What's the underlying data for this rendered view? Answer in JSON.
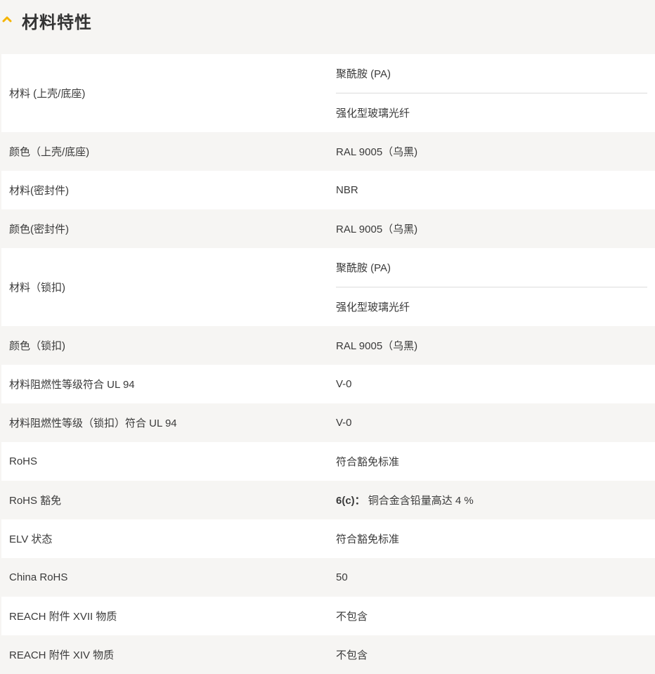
{
  "section": {
    "title": "材料特性",
    "icon": "chevron-up-icon",
    "accent_color": "#f5b400"
  },
  "rows": [
    {
      "label": "材料 (上壳/底座)",
      "values": [
        "聚酰胺 (PA)",
        "强化型玻璃光纤"
      ]
    },
    {
      "label": "颜色（上壳/底座)",
      "values": [
        "RAL 9005（乌黑)"
      ]
    },
    {
      "label": "材料(密封件)",
      "values": [
        "NBR"
      ]
    },
    {
      "label": "颜色(密封件)",
      "values": [
        "RAL 9005（乌黑)"
      ]
    },
    {
      "label": "材料（锁扣)",
      "values": [
        "聚酰胺 (PA)",
        "强化型玻璃光纤"
      ]
    },
    {
      "label": "颜色（锁扣)",
      "values": [
        "RAL 9005（乌黑)"
      ]
    },
    {
      "label": "材料阻燃性等级符合 UL 94",
      "values": [
        "V-0"
      ]
    },
    {
      "label": "材料阻燃性等级（锁扣）符合 UL 94",
      "values": [
        "V-0"
      ]
    },
    {
      "label": "RoHS",
      "values": [
        "符合豁免标准"
      ]
    },
    {
      "label": "RoHS 豁免",
      "values": [
        "铜合金含铅量高达 4 %"
      ],
      "value_prefix": "6(c)："
    },
    {
      "label": "ELV 状态",
      "values": [
        "符合豁免标准"
      ]
    },
    {
      "label": "China RoHS",
      "values": [
        "50"
      ]
    },
    {
      "label": "REACH 附件 XVII 物质",
      "values": [
        "不包含"
      ]
    },
    {
      "label": "REACH 附件 XIV 物质",
      "values": [
        "不包含"
      ]
    }
  ]
}
